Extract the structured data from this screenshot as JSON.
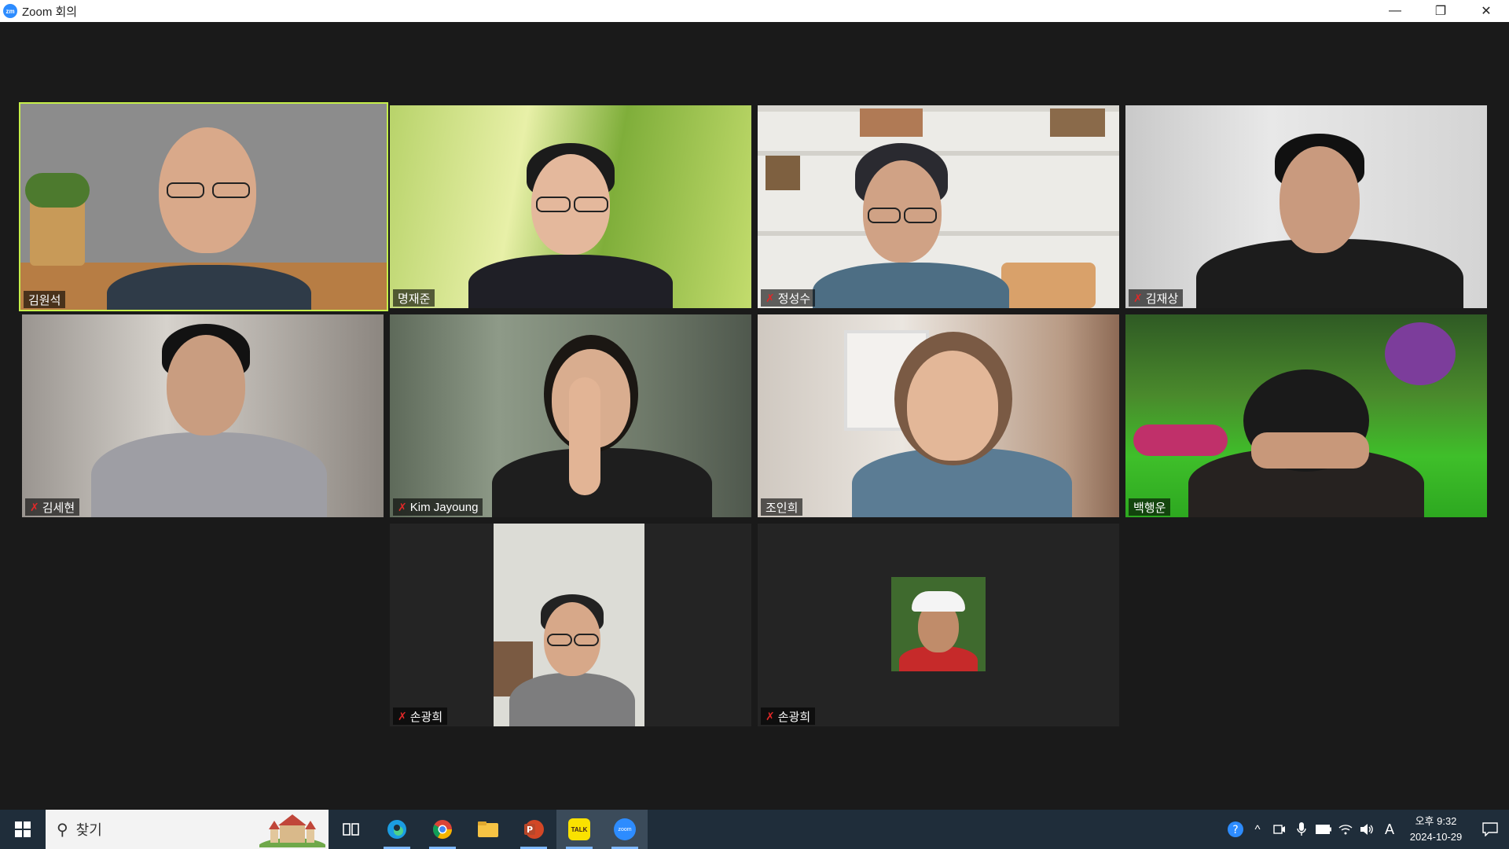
{
  "window": {
    "title": "Zoom 회의",
    "app_icon_text": "zm"
  },
  "controls": {
    "minimize": "—",
    "restore": "❐",
    "close": "✕"
  },
  "participants": [
    {
      "name": "김원석",
      "muted": false,
      "active_speaker": true
    },
    {
      "name": "명재준",
      "muted": false,
      "active_speaker": false
    },
    {
      "name": "정성수",
      "muted": true,
      "active_speaker": false
    },
    {
      "name": "김재상",
      "muted": true,
      "active_speaker": false
    },
    {
      "name": "김세현",
      "muted": true,
      "active_speaker": false
    },
    {
      "name": "Kim Jayoung",
      "muted": true,
      "active_speaker": false
    },
    {
      "name": "조인희",
      "muted": false,
      "active_speaker": false
    },
    {
      "name": "백행운",
      "muted": false,
      "active_speaker": false
    },
    {
      "name": "손광희",
      "muted": true,
      "active_speaker": false
    },
    {
      "name": "손광희",
      "muted": true,
      "active_speaker": false
    }
  ],
  "taskbar": {
    "search_placeholder": "찾기",
    "apps": [
      "task-view",
      "edge",
      "chrome",
      "file-explorer",
      "powerpoint",
      "kakaotalk",
      "zoom"
    ],
    "kakao_label": "TALK",
    "zoom_label": "zoom",
    "clock_time": "오후 9:32",
    "clock_date": "2024-10-29",
    "input_indicator": "A"
  },
  "colors": {
    "active_border": "#c6ef4a",
    "muted_icon": "#e02828",
    "taskbar_bg": "#1f2d3a"
  }
}
